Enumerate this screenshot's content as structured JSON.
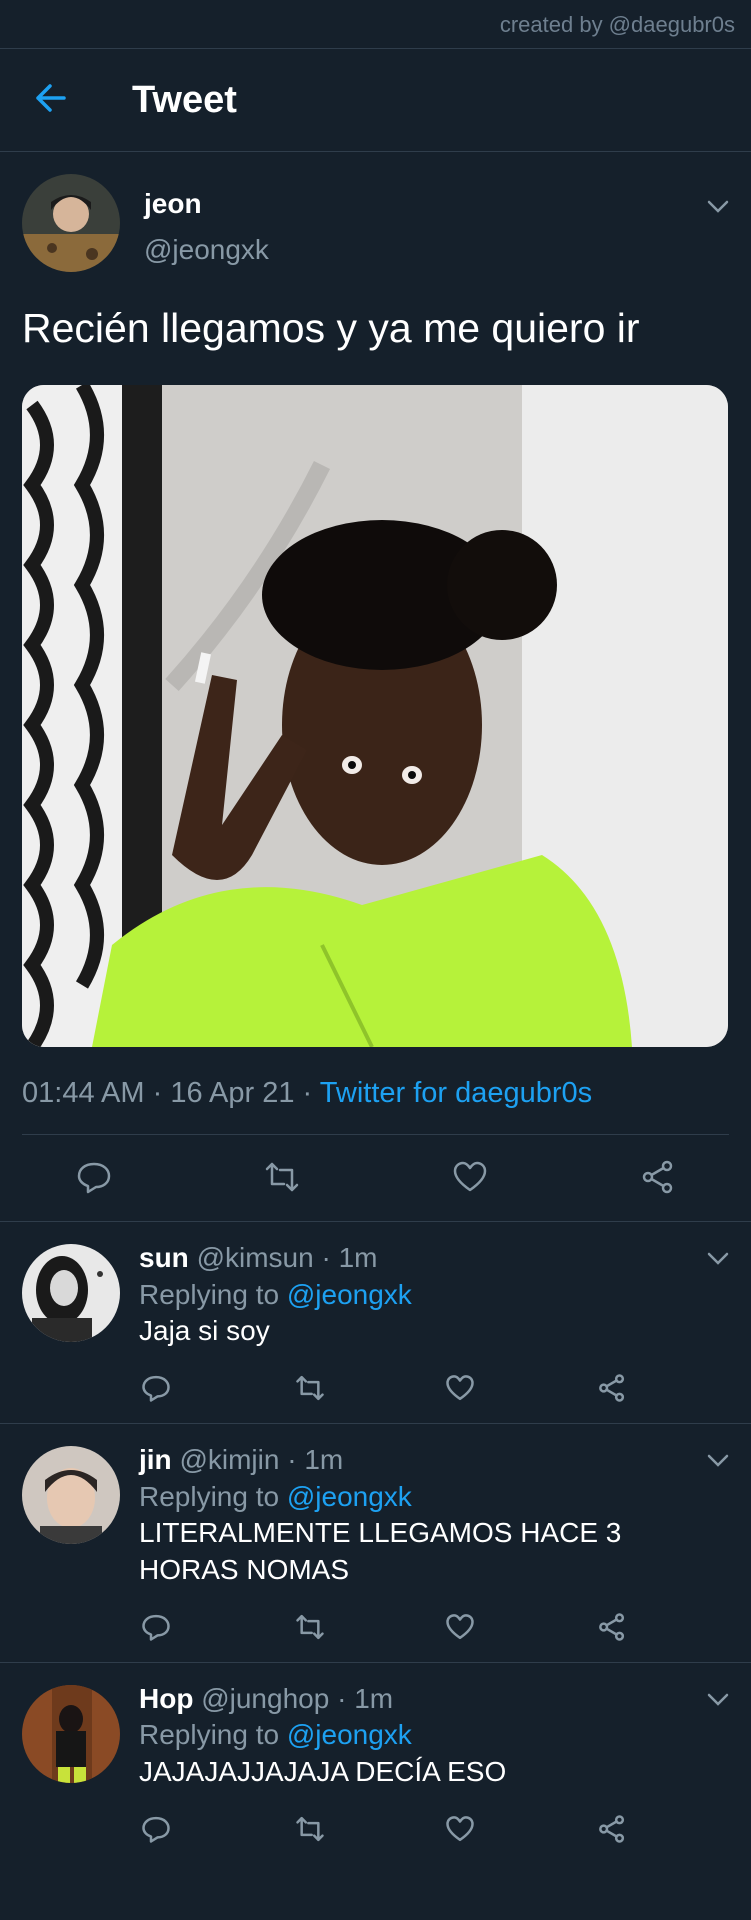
{
  "credit": "created by @daegubr0s",
  "header": {
    "title": "Tweet"
  },
  "tweet": {
    "author_name": "jeon",
    "author_handle": "@jeongxk",
    "text": "Recién llegamos y ya me quiero ir",
    "time": "01:44 AM",
    "date": "16 Apr 21",
    "separator": "·",
    "source": "Twitter for daegubr0s"
  },
  "replies": [
    {
      "name": "sun",
      "handle": "@kimsun",
      "time": "1m",
      "replying_label": "Replying to",
      "replying_to": "@jeongxk",
      "text": "Jaja si soy"
    },
    {
      "name": "jin",
      "handle": "@kimjin",
      "time": "1m",
      "replying_label": "Replying to",
      "replying_to": "@jeongxk",
      "text": "LITERALMENTE LLEGAMOS HACE 3 HORAS NOMAS"
    },
    {
      "name": "Hop",
      "handle": "@junghop",
      "time": "1m",
      "replying_label": "Replying to",
      "replying_to": "@jeongxk",
      "text": "JAJAJAJJAJAJA DECÍA ESO"
    }
  ],
  "colors": {
    "background": "#15202b",
    "accent": "#1da1f2",
    "muted": "#8899a6",
    "divider": "#2f3d4b"
  },
  "icons": [
    "back-arrow-icon",
    "chevron-down-icon",
    "reply-icon",
    "retweet-icon",
    "like-icon",
    "share-icon"
  ]
}
